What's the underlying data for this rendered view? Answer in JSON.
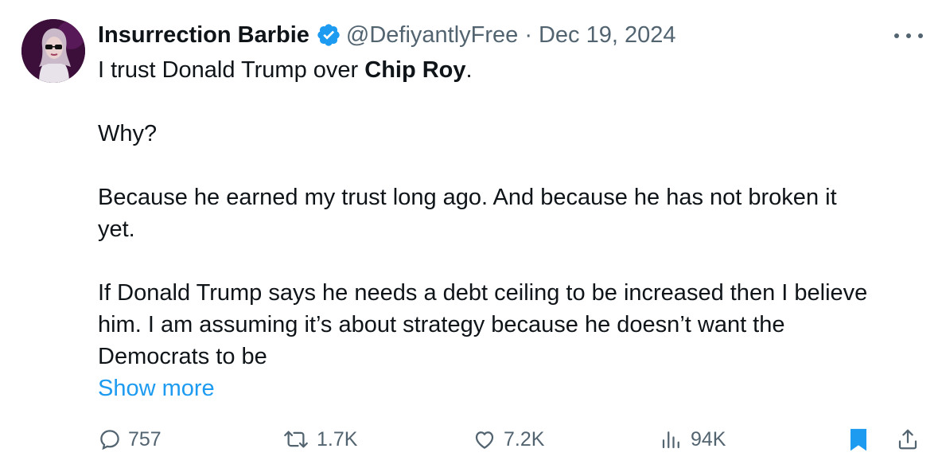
{
  "author": {
    "name": "Insurrection Barbie",
    "handle": "@DefiyantlyFree",
    "separator": "·",
    "date": "Dec 19, 2024"
  },
  "tweet": {
    "line1_prefix": "I trust Donald Trump over ",
    "line1_bold": "Chip Roy",
    "line1_suffix": ".",
    "para2": "Why?",
    "para3_line1": "Because he earned my trust long ago. And because he has not broken it",
    "para3_line2": "yet.",
    "para4_line1": "If Donald Trump says he needs a debt ceiling to be increased then I believe",
    "para4_line2": "him. I am assuming it’s about strategy because he doesn’t want the",
    "para4_line3": "Democrats to be",
    "show_more": "Show more"
  },
  "actions": {
    "replies": "757",
    "reposts": "1.7K",
    "likes": "7.2K",
    "views": "94K"
  },
  "colors": {
    "text": "#0f1419",
    "secondary": "#536471",
    "accent": "#1d9bf0"
  },
  "icons": [
    "verified-badge-icon",
    "more-icon",
    "reply-icon",
    "repost-icon",
    "like-icon",
    "views-icon",
    "bookmark-icon",
    "share-icon"
  ]
}
